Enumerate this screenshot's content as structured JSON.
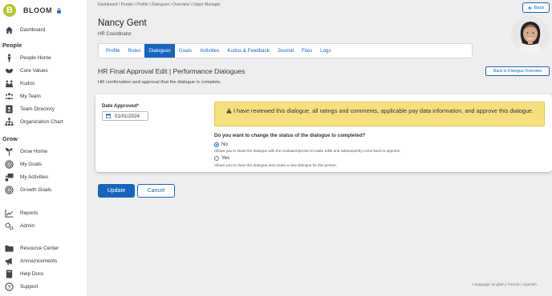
{
  "brand": {
    "name": "BLOOM",
    "logo_letter": "B"
  },
  "sidebar": {
    "sections": {
      "people": "People",
      "grow": "Grow"
    },
    "items": [
      {
        "label": "Dashboard",
        "icon": "home-icon"
      },
      {
        "label": "People Home",
        "icon": "person-icon"
      },
      {
        "label": "Core Values",
        "icon": "handshake-icon"
      },
      {
        "label": "Kudos",
        "icon": "kudos-icon"
      },
      {
        "label": "My Team",
        "icon": "team-icon"
      },
      {
        "label": "Team Directory",
        "icon": "directory-icon"
      },
      {
        "label": "Organization Chart",
        "icon": "org-chart-icon"
      },
      {
        "label": "Grow Home",
        "icon": "sprout-icon"
      },
      {
        "label": "My Goals",
        "icon": "target-icon"
      },
      {
        "label": "My Activities",
        "icon": "activities-icon"
      },
      {
        "label": "Growth Goals",
        "icon": "target-icon"
      },
      {
        "label": "Reports",
        "icon": "line-chart-icon"
      },
      {
        "label": "Admin",
        "icon": "gears-icon"
      },
      {
        "label": "Resource Center",
        "icon": "folder-icon"
      },
      {
        "label": "Announcements",
        "icon": "megaphone-icon"
      },
      {
        "label": "Help Docs",
        "icon": "book-icon"
      },
      {
        "label": "Support",
        "icon": "question-icon"
      }
    ]
  },
  "breadcrumb": "Dashboard \\ People \\ Profile \\ Dialogues \\ Overview \\ Upper Manager",
  "back_button": "Back",
  "person": {
    "name": "Nancy Gent",
    "title": "HR Coordinator"
  },
  "tabs": [
    {
      "label": "Profile",
      "active": false
    },
    {
      "label": "Roles",
      "active": false
    },
    {
      "label": "Dialogues",
      "active": true
    },
    {
      "label": "Goals",
      "active": false
    },
    {
      "label": "Activities",
      "active": false
    },
    {
      "label": "Kudos & Feedback",
      "active": false
    },
    {
      "label": "Journal",
      "active": false
    },
    {
      "label": "Files",
      "active": false
    },
    {
      "label": "Logs",
      "active": false
    }
  ],
  "page": {
    "heading": "HR Final Approval Edit | Performance Dialogues",
    "description": "HR confirmation and approval that the dialogue is complete.",
    "back_overview": "Back to Dialogue Overview"
  },
  "form": {
    "date_label": "Date Approved",
    "date_required_mark": "*",
    "date_value": "01/01/2024",
    "warning": "I have reviewed this dialogue, all ratings and comments, applicable pay data information, and approve this dialogue.",
    "question": "Do you want to change the status of the dialogue to completed?",
    "option_no": "No",
    "option_no_help": "Allows you to share the dialogue with the evaluator/person to make edits and subsequently come back to approve.",
    "option_yes": "Yes",
    "option_yes_help": "Allows you to close this dialogue and create a new dialogue for this person.",
    "selected": "No"
  },
  "actions": {
    "update": "Update",
    "cancel": "Cancel"
  },
  "footer": {
    "language": "Language: English | French | Spanish"
  },
  "colors": {
    "primary": "#1565c0",
    "brand": "#b5c72a",
    "warning_bg": "#f8df7e",
    "page_bg": "#eeeeee"
  }
}
